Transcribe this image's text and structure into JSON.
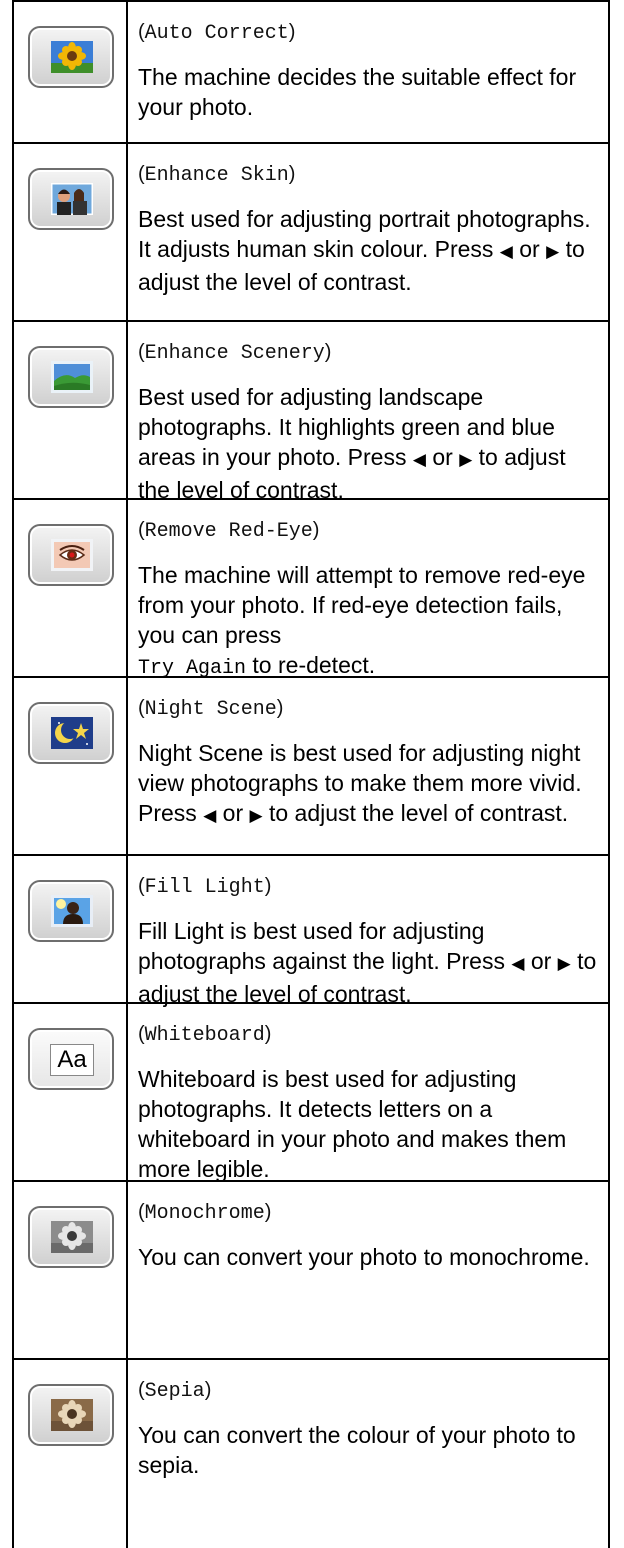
{
  "rows": [
    {
      "icon": "sunflower-icon",
      "name": "Auto Correct",
      "desc": "The machine decides the suitable effect for your photo."
    },
    {
      "icon": "portrait-icon",
      "name": "Enhance Skin",
      "desc_a": "Best used for adjusting portrait photographs. It adjusts human skin colour. Press",
      "or": "or",
      "desc_b": "to adjust the level of contrast."
    },
    {
      "icon": "landscape-icon",
      "name": "Enhance Scenery",
      "desc_a": "Best used for adjusting landscape photographs. It highlights green and blue areas in your photo. Press",
      "or": "or",
      "desc_b": "to adjust the level of contrast."
    },
    {
      "icon": "red-eye-icon",
      "name": "Remove Red-Eye",
      "desc_a": "The machine will attempt to remove red-eye from your photo. If red-eye detection fails, you can press",
      "key": "Try Again",
      "desc_b": "to re-detect."
    },
    {
      "icon": "night-moon-icon",
      "name": "Night Scene",
      "desc_a": "Night Scene is best used for adjusting night view photographs to make them more vivid. Press",
      "or": "or",
      "desc_b": "to adjust the level of contrast."
    },
    {
      "icon": "backlit-person-icon",
      "name": "Fill Light",
      "desc_a": "Fill Light is best used for adjusting photographs against the light. Press",
      "or": "or",
      "desc_b": "to adjust the level of contrast."
    },
    {
      "icon": "whiteboard-aa-icon",
      "icon_text": "Aa",
      "name": "Whiteboard",
      "desc": "Whiteboard is best used for adjusting photographs. It detects letters on a whiteboard in your photo and makes them more legible."
    },
    {
      "icon": "monochrome-flower-icon",
      "name": "Monochrome",
      "desc": "You can convert your photo to monochrome."
    },
    {
      "icon": "sepia-flower-icon",
      "name": "Sepia",
      "desc": "You can convert the colour of your photo to sepia."
    }
  ]
}
